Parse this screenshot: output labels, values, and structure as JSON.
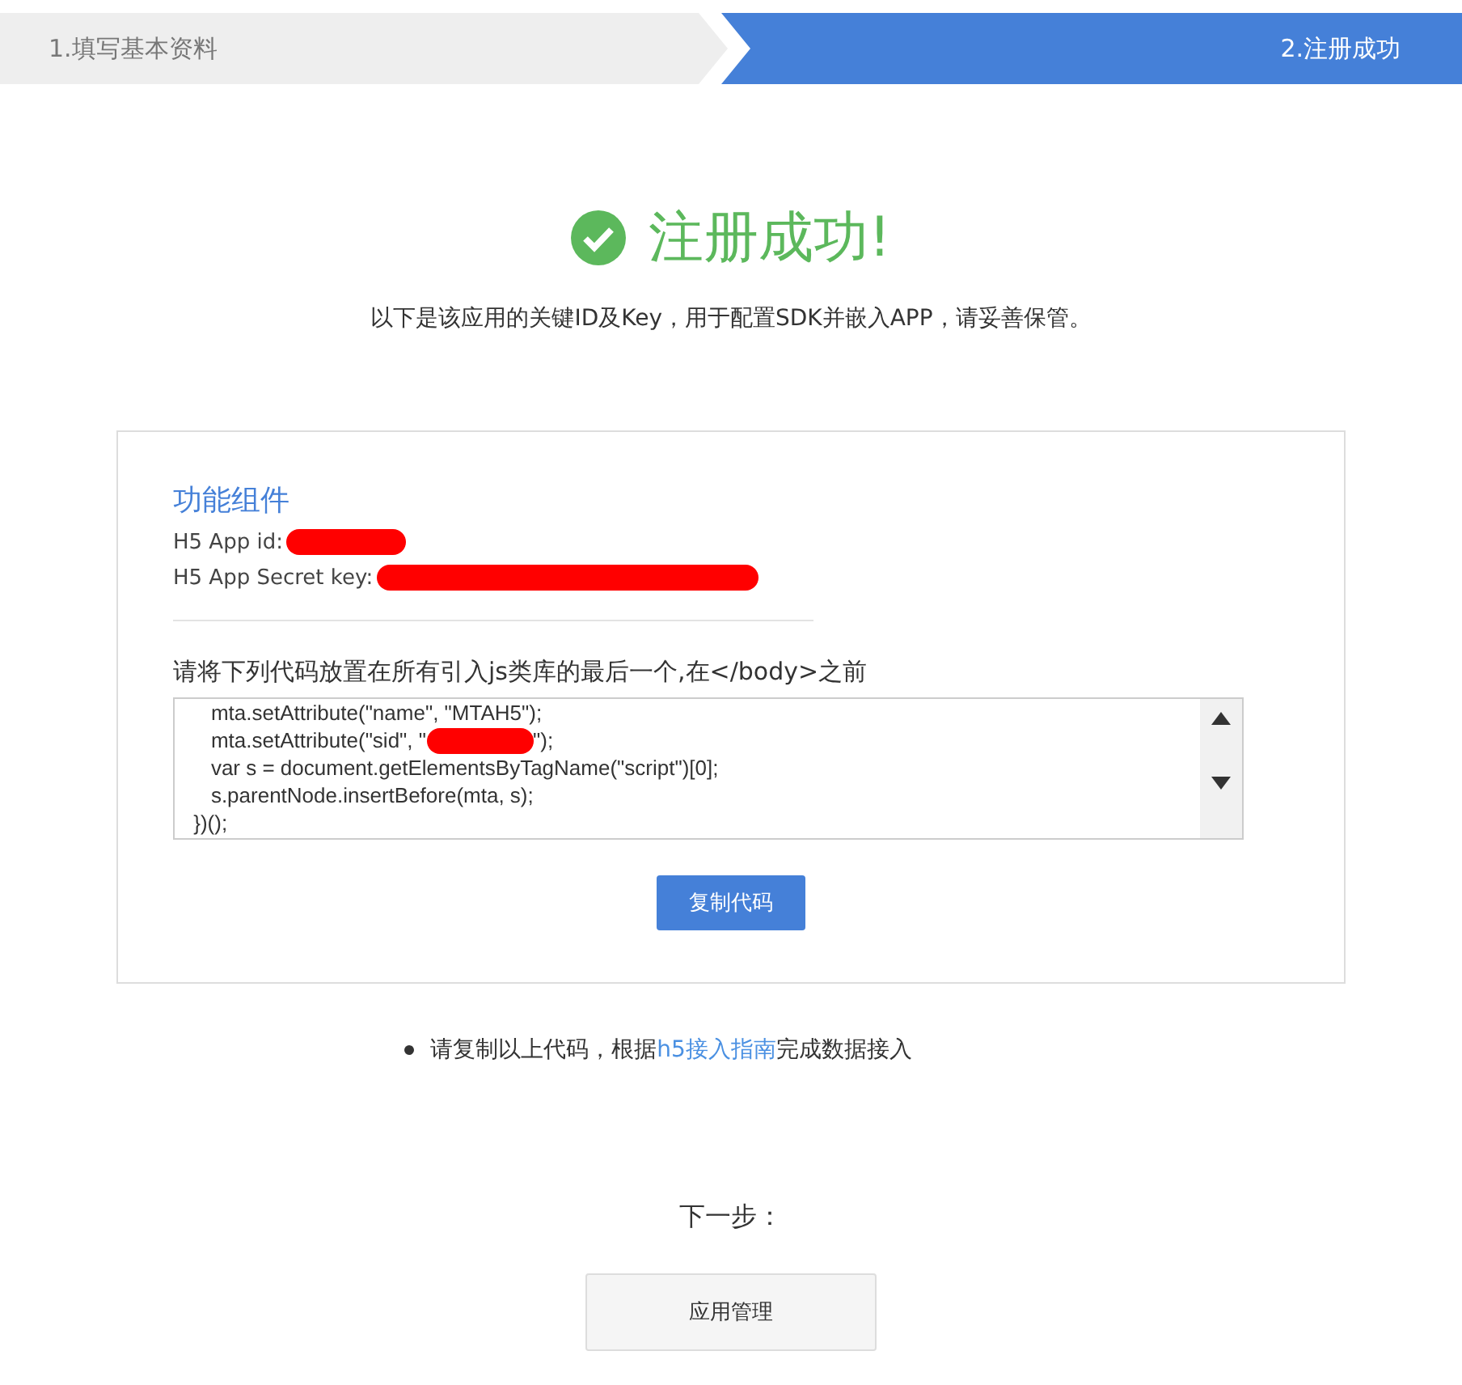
{
  "steps": [
    {
      "label": "1.填写基本资料",
      "selected": false
    },
    {
      "label": "2.注册成功",
      "selected": true
    }
  ],
  "success": {
    "title": "注册成功!",
    "subtitle": "以下是该应用的关键ID及Key，用于配置SDK并嵌入APP，请妥善保管。"
  },
  "card": {
    "title": "功能组件",
    "fields": [
      {
        "label": "H5 App id:"
      },
      {
        "label": "H5 App Secret key:"
      }
    ],
    "instruction": "请将下列代码放置在所有引入js类库的最后一个,在</body>之前",
    "code_lines": [
      {
        "before": "    mta.setAttribute(\"name\", \"MTAH5\");",
        "redacted": false
      },
      {
        "before": "    mta.setAttribute(\"sid\", \"",
        "after": "\");",
        "redacted": true
      },
      {
        "before": "    var s = document.getElementsByTagName(\"script\")[0];",
        "redacted": false
      },
      {
        "before": "    s.parentNode.insertBefore(mta, s);",
        "redacted": false
      },
      {
        "before": " })();",
        "redacted": false
      }
    ],
    "copy_button": "复制代码"
  },
  "hint": {
    "before": "请复制以上代码，根据",
    "link": "h5接入指南",
    "after": "完成数据接入"
  },
  "next": {
    "label": "下一步：",
    "button": "应用管理"
  }
}
